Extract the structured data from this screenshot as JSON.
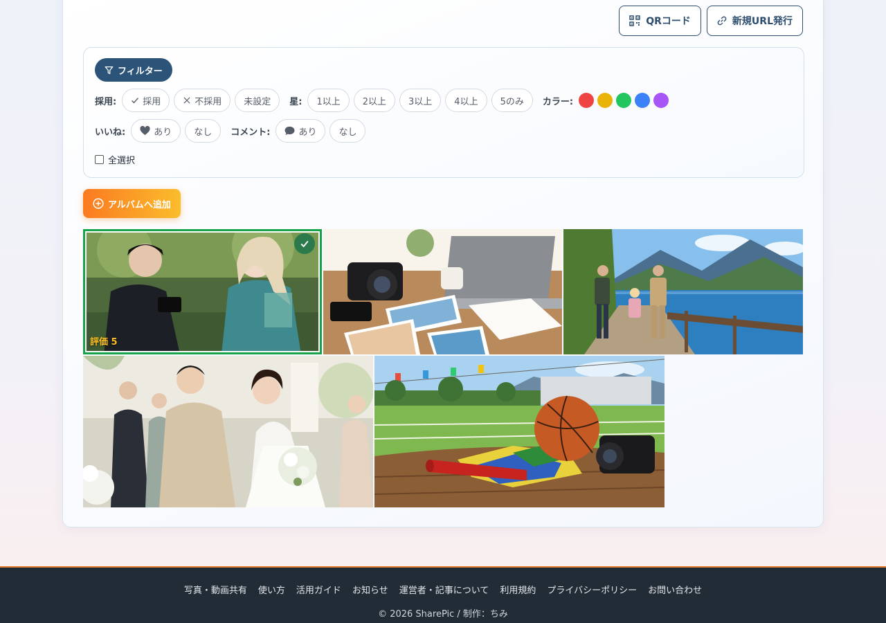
{
  "actions": {
    "qr_label": "QRコード",
    "new_url_label": "新規URL発行"
  },
  "filter": {
    "toggle_label": "フィルター",
    "adoption": {
      "label": "採用:",
      "options": [
        "採用",
        "不採用",
        "未設定"
      ]
    },
    "stars": {
      "label": "星:",
      "options": [
        "1以上",
        "2以上",
        "3以上",
        "4以上",
        "5のみ"
      ]
    },
    "color": {
      "label": "カラー:",
      "swatches": [
        "#ef4444",
        "#eab308",
        "#22c55e",
        "#3b82f6",
        "#a855f7"
      ]
    },
    "likes": {
      "label": "いいね:",
      "options": [
        "あり",
        "なし"
      ]
    },
    "comments": {
      "label": "コメント:",
      "options": [
        "あり",
        "なし"
      ]
    },
    "select_all": "全選択"
  },
  "album_button": "アルバムへ追加",
  "photos": [
    {
      "subject": "cosplay-photographer",
      "selected": true,
      "rating": "評価 5"
    },
    {
      "subject": "desk-camera-prints",
      "selected": false
    },
    {
      "subject": "family-lake-hike",
      "selected": false
    },
    {
      "subject": "wedding-couple",
      "selected": false
    },
    {
      "subject": "sports-day-basketball",
      "selected": false
    }
  ],
  "footer": {
    "links": [
      "写真・動画共有",
      "使い方",
      "活用ガイド",
      "お知らせ",
      "運営者・記事について",
      "利用規約",
      "プライバシーポリシー",
      "お問い合わせ"
    ],
    "copyright": "© 2026 SharePic / 制作：ちみ"
  }
}
